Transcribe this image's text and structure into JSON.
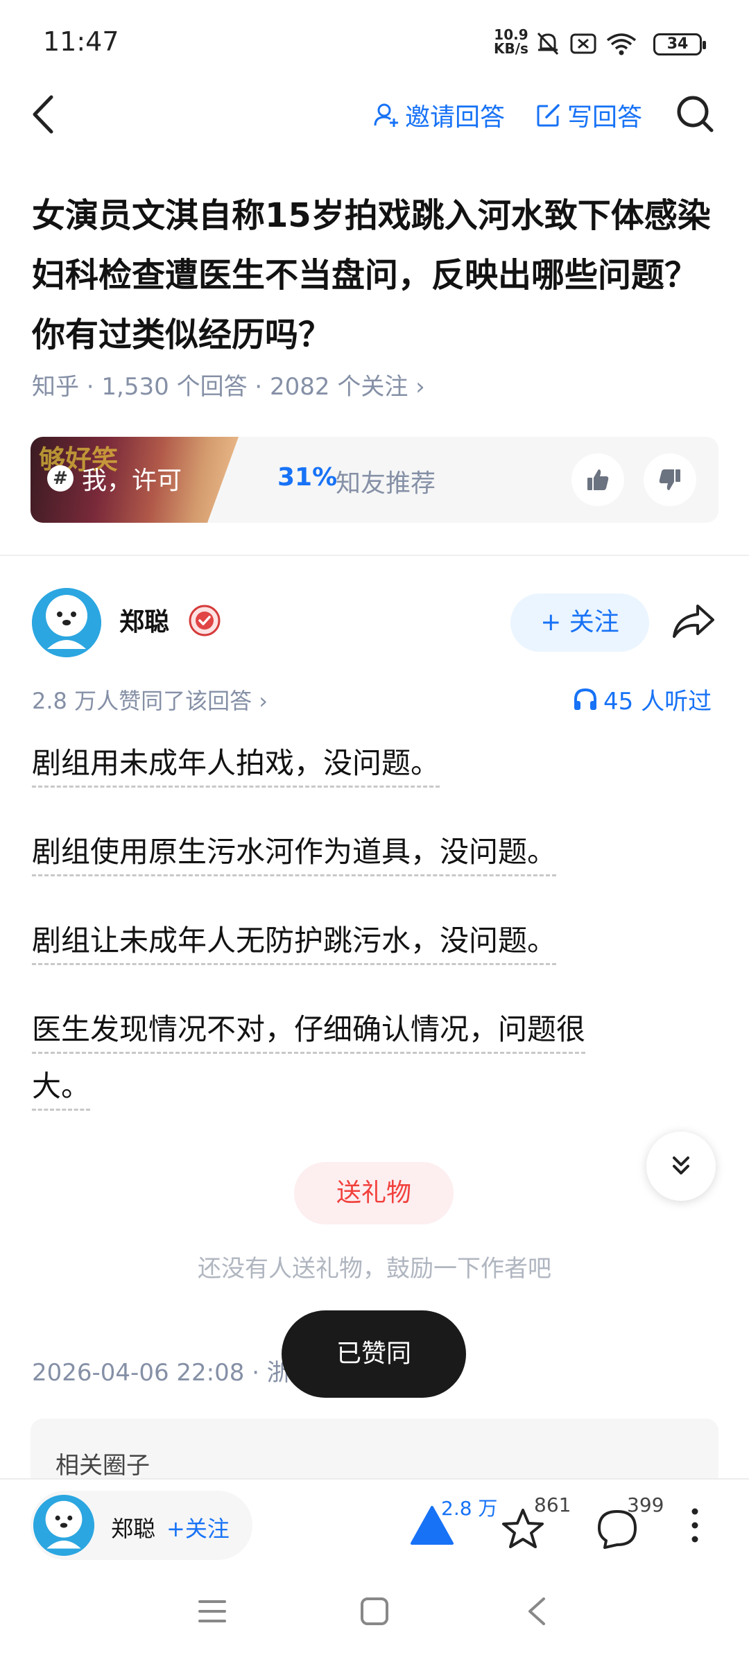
{
  "status_bar": {
    "time": "11:47",
    "net_speed_value": "10.9",
    "net_speed_unit": "KB/s",
    "battery": "34"
  },
  "header": {
    "invite_label": "邀请回答",
    "write_label": "写回答"
  },
  "question": {
    "title": "女演员文淇自称15岁拍戏跳入河水致下体感染妇科检查遭医生不当盘问，反映出哪些问题？你有过类似经历吗？",
    "meta": "知乎 · 1,530 个回答 · 2082 个关注 ›"
  },
  "recommend": {
    "tag": "我，许可",
    "thumb_text": "够好笑",
    "percent": "31%",
    "label": "知友推荐"
  },
  "answer": {
    "author": "郑聪",
    "follow_label": "+ 关注",
    "upvote_info": "2.8 万人赞同了该回答 ›",
    "listened": "45 人听过",
    "paragraphs": [
      "剧组用未成年人拍戏，没问题。",
      "剧组使用原生污水河作为道具，没问题。",
      "剧组让未成年人无防护跳污水，没问题。",
      "医生发现情况不对，仔细确认情况，问题很",
      "大。"
    ],
    "gift_label": "送礼物",
    "gift_tip": "还没有人送礼物，鼓励一下作者吧",
    "publish_time": "2026-04-06 22:08 · 浙",
    "toast": "已赞同",
    "related_label": "相关圈子"
  },
  "bottom_bar": {
    "author": "郑聪",
    "follow_label": "+关注",
    "upvote_count": "2.8 万",
    "favorite_count": "861",
    "comment_count": "399"
  },
  "colors": {
    "accent": "#1772f6",
    "text": "#121212",
    "meta": "#8590a6",
    "gift": "#f1403c"
  }
}
